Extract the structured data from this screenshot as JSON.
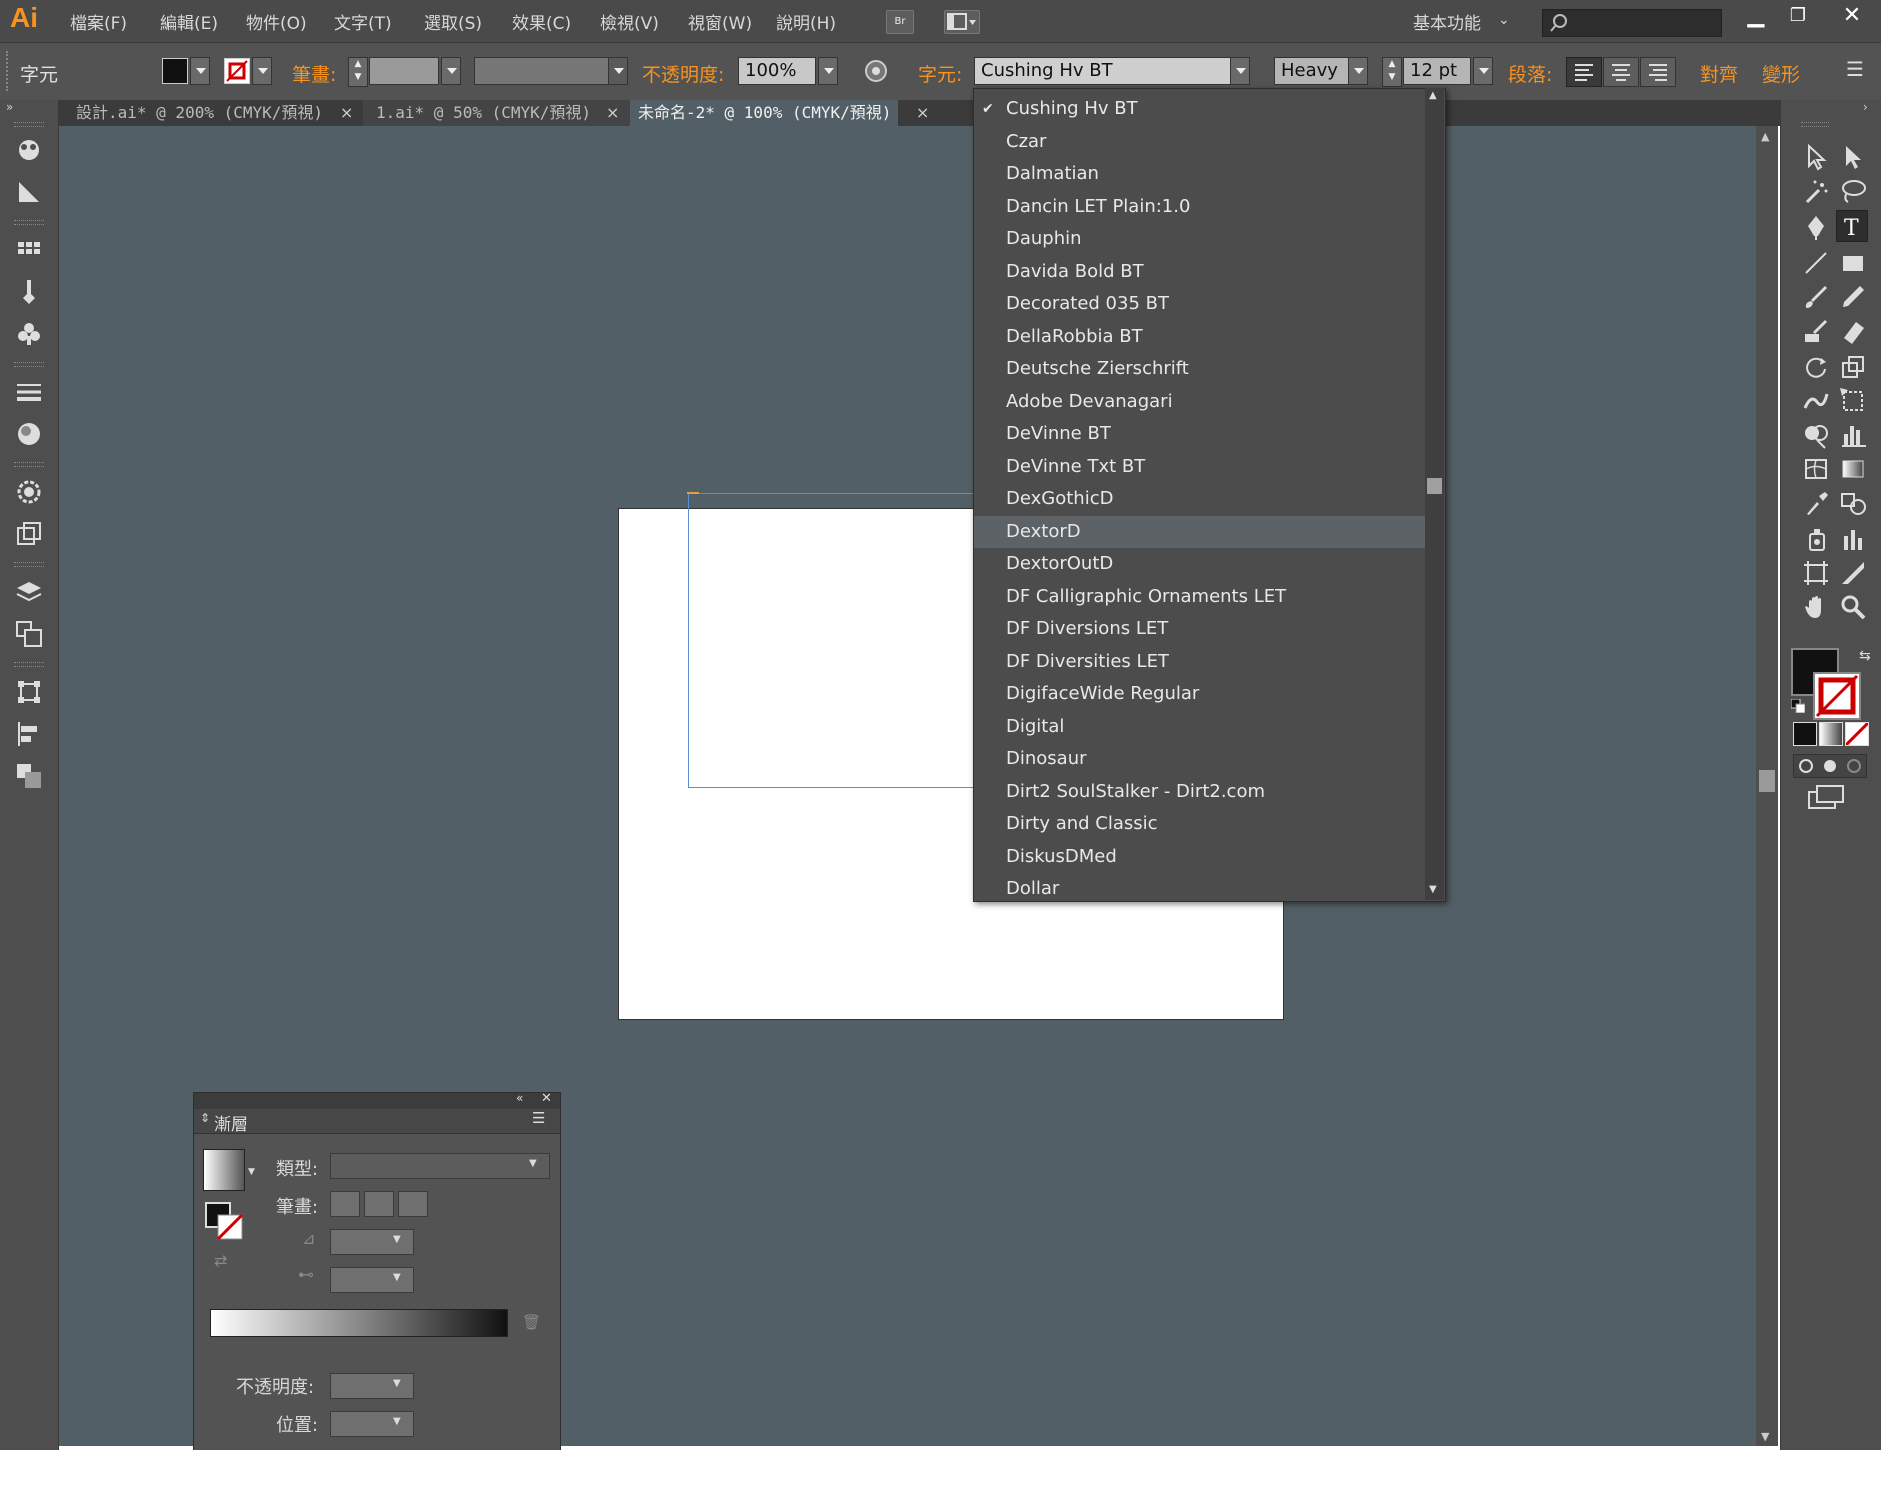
{
  "app": {
    "logo": "Ai"
  },
  "menubar": {
    "items": [
      "檔案(F)",
      "編輯(E)",
      "物件(O)",
      "文字(T)",
      "選取(S)",
      "效果(C)",
      "檢視(V)",
      "視窗(W)",
      "說明(H)"
    ],
    "bridge_label": "Br",
    "workspace_label": "基本功能",
    "search_placeholder": ""
  },
  "controlbar": {
    "panel_name": "字元",
    "stroke_label": "筆畫:",
    "opacity_label": "不透明度:",
    "opacity_value": "100%",
    "char_label": "字元:",
    "font_value": "Cushing Hv BT",
    "style_value": "Heavy",
    "size_value": "12 pt",
    "paragraph_label": "段落:",
    "align_label": "對齊",
    "transform_label": "變形"
  },
  "tabs": [
    {
      "label": "設計.ai* @ 200% (CMYK/預視)",
      "close": "×"
    },
    {
      "label": "1.ai* @ 50% (CMYK/預視)",
      "close": "×"
    },
    {
      "label": "未命名-2* @ 100% (CMYK/預視)",
      "close": "×",
      "active": true
    }
  ],
  "font_dropdown": {
    "checked_index": 0,
    "highlighted_index": 13,
    "check_mark": "✔",
    "fonts": [
      "Cushing Hv BT",
      "Czar",
      "Dalmatian",
      "Dancin LET Plain:1.0",
      "Dauphin",
      "Davida Bold BT",
      "Decorated 035 BT",
      "DellaRobbia BT",
      "Deutsche Zierschrift",
      "Adobe Devanagari",
      "DeVinne BT",
      "DeVinne Txt BT",
      "DexGothicD",
      "DextorD",
      "DextorOutD",
      "DF Calligraphic Ornaments LET",
      "DF Diversions LET",
      "DF Diversities LET",
      "DigifaceWide Regular",
      "Digital",
      "Dinosaur",
      "Dirt2 SoulStalker - Dirt2.com",
      "Dirty and Classic",
      "DiskusDMed",
      "Dollar"
    ]
  },
  "gradient_panel": {
    "title": "漸層",
    "type_label": "類型:",
    "stroke_label": "筆畫:",
    "opacity_label": "不透明度:",
    "location_label": "位置:"
  },
  "colors": {
    "accent": "#f7931e",
    "canvas": "#535f66",
    "panel": "#535353",
    "highlight": "#5c6266",
    "selection": "#5b8fd2"
  }
}
